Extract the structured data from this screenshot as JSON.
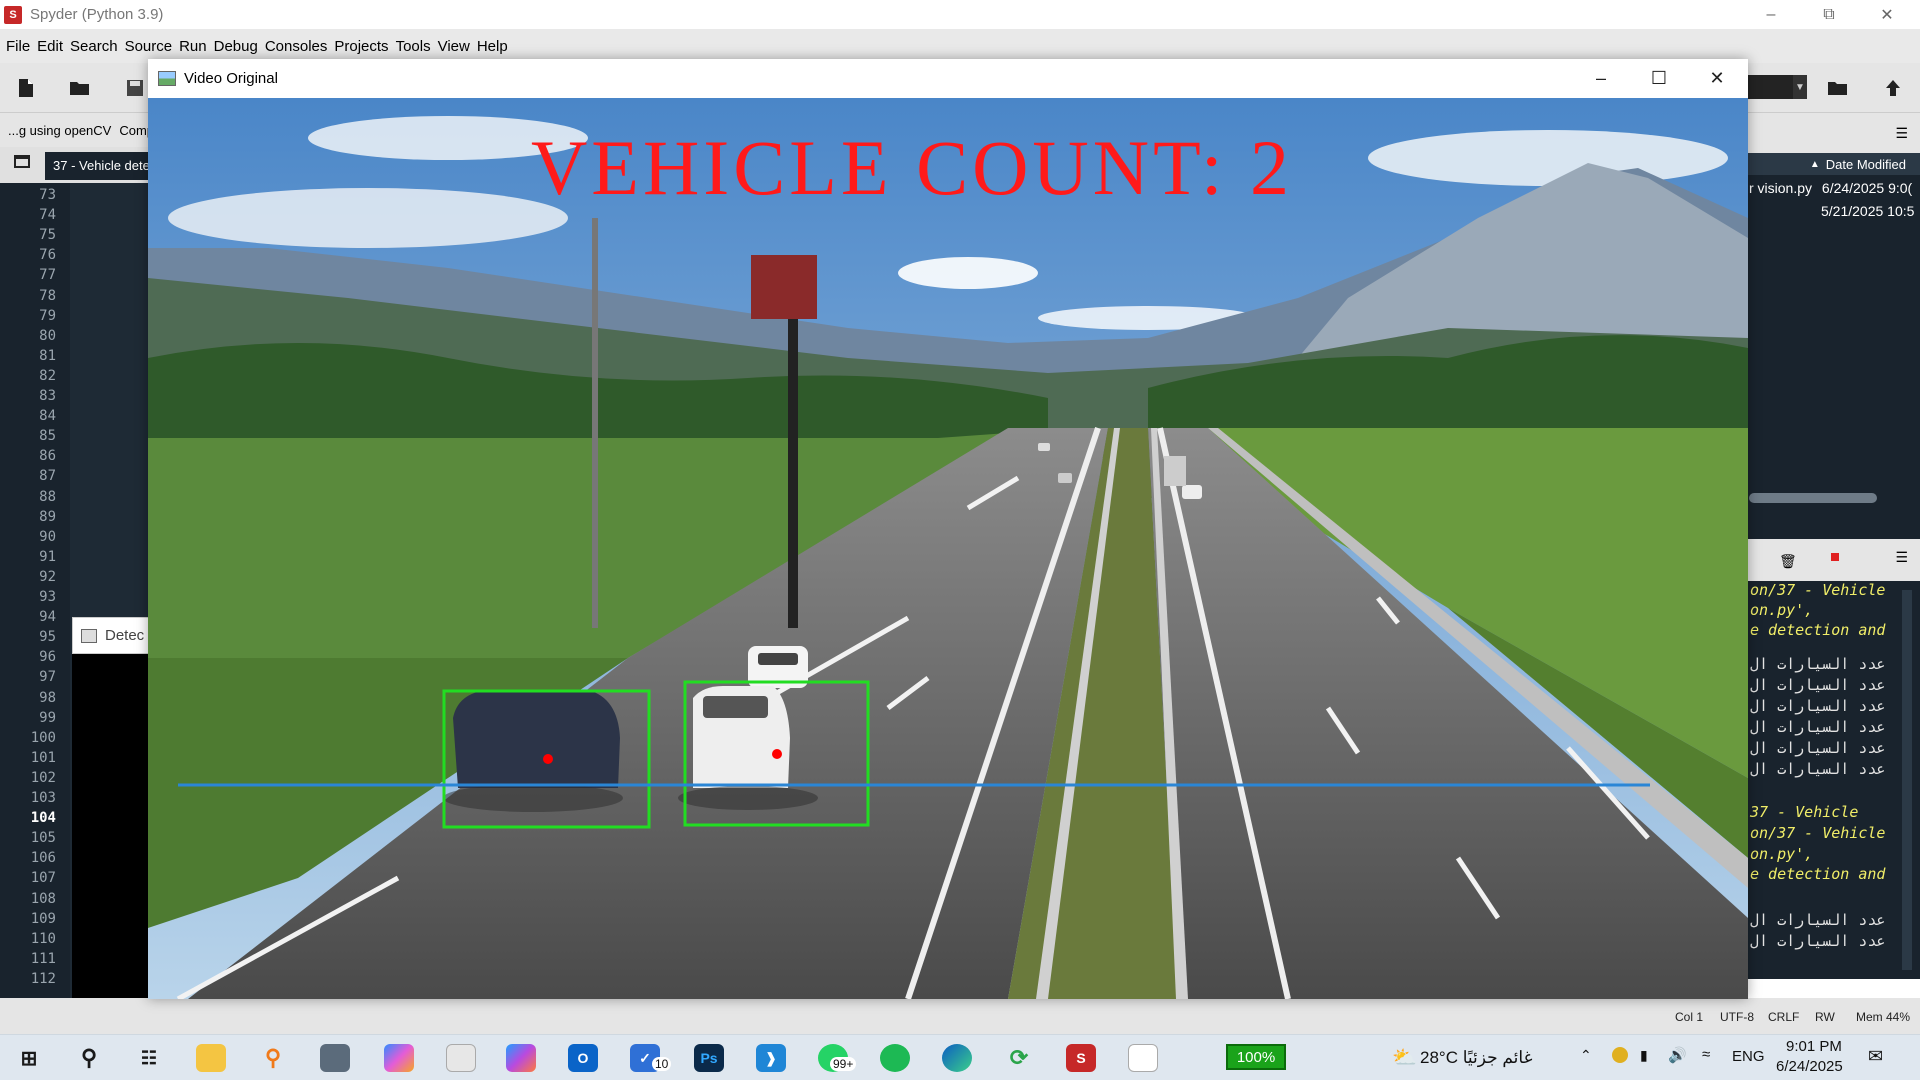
{
  "spyder": {
    "title": "Spyder (Python 3.9)",
    "logo_text": "S",
    "menu": [
      "File",
      "Edit",
      "Search",
      "Source",
      "Run",
      "Debug",
      "Consoles",
      "Projects",
      "Tools",
      "View",
      "Help"
    ],
    "breadcrumb": "...g using openCV",
    "breadcrumb_extra": "Comp",
    "editor_tab": "37 - Vehicle dete",
    "line_numbers": [
      "73",
      "74",
      "75",
      "76",
      "77",
      "78",
      "79",
      "80",
      "81",
      "82",
      "83",
      "84",
      "85",
      "86",
      "87",
      "88",
      "89",
      "90",
      "91",
      "92",
      "93",
      "94",
      "95",
      "96",
      "97",
      "98",
      "99",
      "100",
      "101",
      "102",
      "103",
      "104",
      "105",
      "106",
      "107",
      "108",
      "109",
      "110",
      "111",
      "112"
    ],
    "current_line": "104"
  },
  "detect_window": {
    "title": "Detec"
  },
  "files_pane": {
    "header": "Date Modified",
    "rows": [
      {
        "name": "r vision.py",
        "date": "6/24/2025 9:0("
      },
      {
        "name": "",
        "date": "5/21/2025 10:5"
      }
    ]
  },
  "console_lines": [
    {
      "text": "on/37 - Vehicle",
      "arabic": false
    },
    {
      "text": "on.py',",
      "arabic": false
    },
    {
      "text": "e detection and",
      "arabic": false
    },
    {
      "text": "عدد السيارات ال",
      "arabic": true
    },
    {
      "text": "عدد السيارات ال",
      "arabic": true
    },
    {
      "text": "عدد السيارات ال",
      "arabic": true
    },
    {
      "text": "عدد السيارات ال",
      "arabic": true
    },
    {
      "text": "عدد السيارات ال",
      "arabic": true
    },
    {
      "text": "عدد السيارات ال",
      "arabic": true
    },
    {
      "text": "37 - Vehicle",
      "arabic": false
    },
    {
      "text": "on/37 - Vehicle",
      "arabic": false
    },
    {
      "text": "on.py',",
      "arabic": false
    },
    {
      "text": "e detection and",
      "arabic": false
    },
    {
      "text": "عدد السيارات ال",
      "arabic": true
    },
    {
      "text": "عدد السيارات ال",
      "arabic": true
    }
  ],
  "statusbar": {
    "col": "Col 1",
    "encoding": "UTF-8",
    "eol": "CRLF",
    "mode": "RW",
    "mem": "Mem 44%"
  },
  "video_window": {
    "title": "Video Original",
    "overlay_text": "VEHICLE COUNT: 2",
    "overlay_color": "#ff1a1a",
    "box_color": "#22dd22",
    "line_color": "#2a86d6",
    "centroid_color": "#ff0000"
  },
  "taskbar": {
    "badges": {
      "todo": "10",
      "whatsapp": "99+"
    },
    "battery": "100%",
    "weather": "28°C  غائم جزئيًا",
    "lang": "ENG",
    "time": "9:01 PM",
    "date": "6/24/2025",
    "icons": [
      "windows-start",
      "search",
      "task-view",
      "file-explorer",
      "search-app",
      "calculator",
      "copilot",
      "microsoft-store",
      "microsoft-365",
      "outlook",
      "microsoft-todo",
      "photoshop",
      "visual-studio-code",
      "whatsapp",
      "spotify",
      "edge",
      "refresh-app",
      "spyder",
      "notepad"
    ]
  }
}
